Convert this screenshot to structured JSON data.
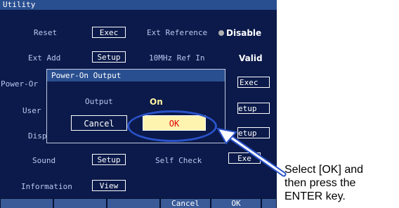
{
  "window": {
    "title": "Utility"
  },
  "rows": {
    "reset": {
      "label": "Reset",
      "button": "Exec"
    },
    "ext_reference": {
      "label": "Ext Reference",
      "value": "Disable"
    },
    "ext_add": {
      "label": "Ext Add",
      "button": "Setup"
    },
    "ref_10mhz": {
      "label": "10MHz Ref In",
      "value": "Valid"
    },
    "power_on": {
      "label": "Power-On",
      "label_visible": "Power-Or"
    },
    "exec_right": {
      "button": "Exec"
    },
    "user": {
      "label": "User"
    },
    "setup_right_1": {
      "button": "Setup",
      "button_visible": "etup"
    },
    "disp": {
      "label": "Disp"
    },
    "setup_right_2": {
      "button": "Setup",
      "button_visible": "etup"
    },
    "sound": {
      "label": "Sound",
      "button": "Setup"
    },
    "self_check": {
      "label": "Self Check",
      "button": "Exec",
      "button_visible": "Exe"
    },
    "information": {
      "label": "Information",
      "button": "View"
    }
  },
  "dialog": {
    "title": "Power-On Output",
    "field_label": "Output",
    "field_value": "On",
    "cancel_label": "Cancel",
    "ok_label": "OK"
  },
  "softkeys": [
    "",
    "",
    "",
    "Cancel",
    "OK",
    ""
  ],
  "annotation": {
    "text": "Select [OK] and then press the ENTER key.",
    "line1": "Select [OK] and",
    "line2": "then press the",
    "line3": "ENTER key."
  },
  "colors": {
    "screen_bg": "#0b1a4a",
    "titlebar": "#2a4f90",
    "ok_highlight": "#fff3b0",
    "ok_text": "#e00000",
    "ring": "#2a52c8"
  }
}
